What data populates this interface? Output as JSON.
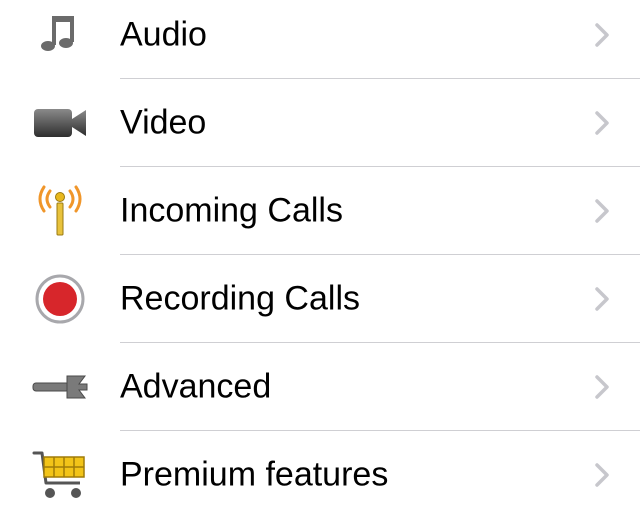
{
  "settings": {
    "items": [
      {
        "label": "Audio",
        "icon": "music-note-icon"
      },
      {
        "label": "Video",
        "icon": "video-camera-icon"
      },
      {
        "label": "Incoming Calls",
        "icon": "antenna-icon"
      },
      {
        "label": "Recording Calls",
        "icon": "record-icon"
      },
      {
        "label": "Advanced",
        "icon": "wrench-icon"
      },
      {
        "label": "Premium features",
        "icon": "shopping-cart-icon"
      }
    ]
  },
  "colors": {
    "chevron": "#c7c7cc",
    "separator": "#cfcfd3",
    "record_red": "#d7262b",
    "antenna_orange": "#f0962a",
    "cart_yellow": "#f2c419"
  }
}
